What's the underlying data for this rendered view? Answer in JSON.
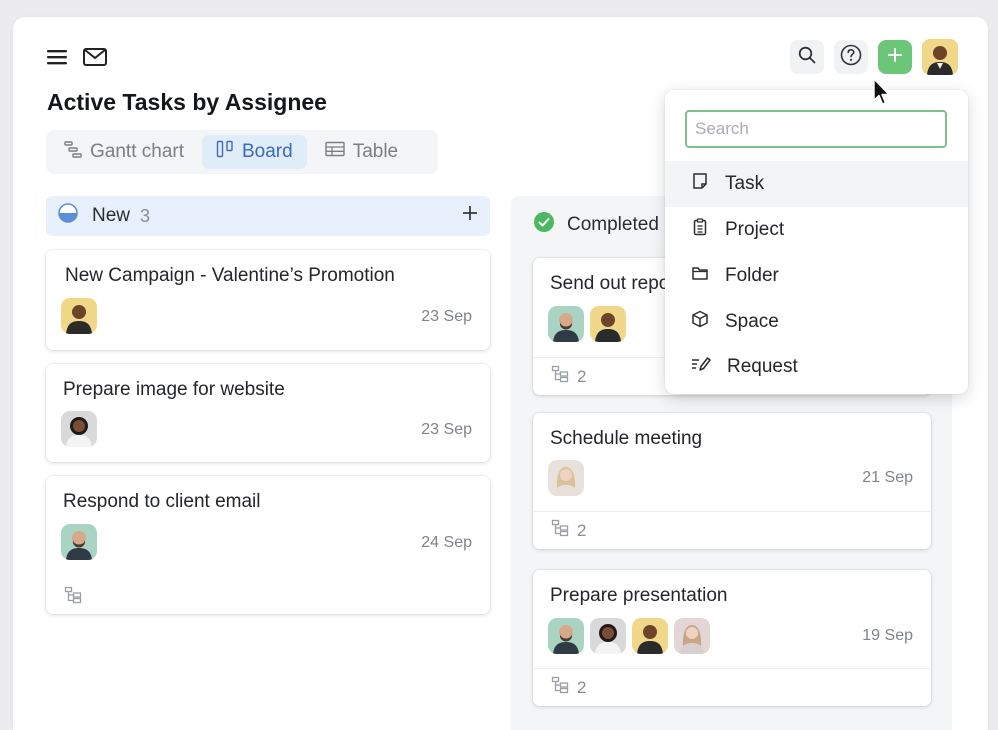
{
  "page": {
    "title": "Active Tasks by Assignee"
  },
  "search": {
    "placeholder": "Search"
  },
  "views": [
    {
      "label": "Gantt chart",
      "icon": "gantt-icon",
      "active": false
    },
    {
      "label": "Board",
      "icon": "board-icon",
      "active": true
    },
    {
      "label": "Table",
      "icon": "table-icon",
      "active": false
    }
  ],
  "columns": {
    "new": {
      "label": "New",
      "count": "3",
      "cards": [
        {
          "title": "New Campaign - Valentine’s Promotion",
          "date": "23 Sep"
        },
        {
          "title": "Prepare image for website",
          "date": "23 Sep"
        },
        {
          "title": "Respond to client email",
          "date": "24 Sep"
        }
      ]
    },
    "completed": {
      "label": "Completed",
      "cards": [
        {
          "title": "Send out report",
          "subtasks": "2"
        },
        {
          "title": "Schedule meeting",
          "date": "21 Sep",
          "subtasks": "2"
        },
        {
          "title": "Prepare presentation",
          "date": "19 Sep",
          "subtasks": "2"
        }
      ]
    }
  },
  "create_menu": {
    "items": [
      {
        "label": "Task",
        "icon": "task-icon"
      },
      {
        "label": "Project",
        "icon": "project-icon"
      },
      {
        "label": "Folder",
        "icon": "folder-icon"
      },
      {
        "label": "Space",
        "icon": "space-icon"
      },
      {
        "label": "Request",
        "icon": "request-icon"
      }
    ]
  },
  "colors": {
    "accent_green": "#6cc67a",
    "board_tab_bg": "#e1ecf9",
    "new_header_bg": "#e7f0fb",
    "completed_check": "#4cb862"
  }
}
